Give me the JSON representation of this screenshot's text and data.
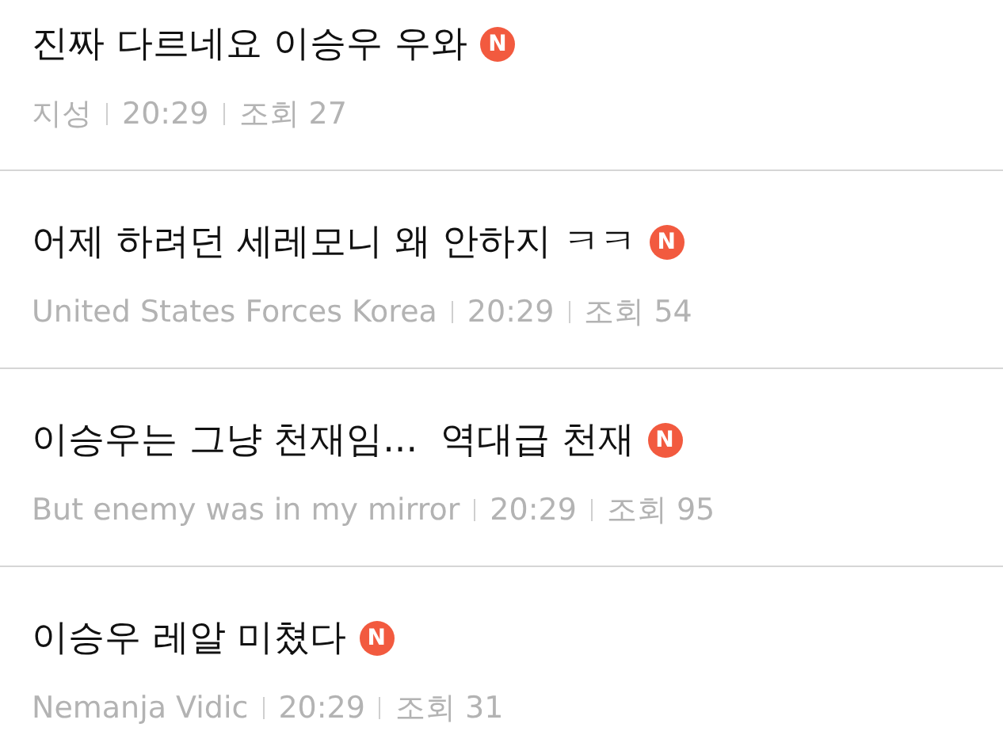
{
  "posts": [
    {
      "title": "진짜 다르네요 이승우 우와",
      "badge": "N",
      "author": "지성",
      "time": "20:29",
      "views": "조회 27"
    },
    {
      "title": "어제 하려던 세레모니 왜 안하지 ㅋㅋ",
      "badge": "N",
      "author": "United States Forces Korea",
      "time": "20:29",
      "views": "조회 54"
    },
    {
      "title": "이승우는 그냥 천재임...  역대급 천재",
      "badge": "N",
      "author": "But enemy was in my mirror",
      "time": "20:29",
      "views": "조회 95"
    },
    {
      "title": "이승우 레알 미쳤다",
      "badge": "N",
      "author": "Nemanja Vidic",
      "time": "20:29",
      "views": "조회 31"
    }
  ]
}
